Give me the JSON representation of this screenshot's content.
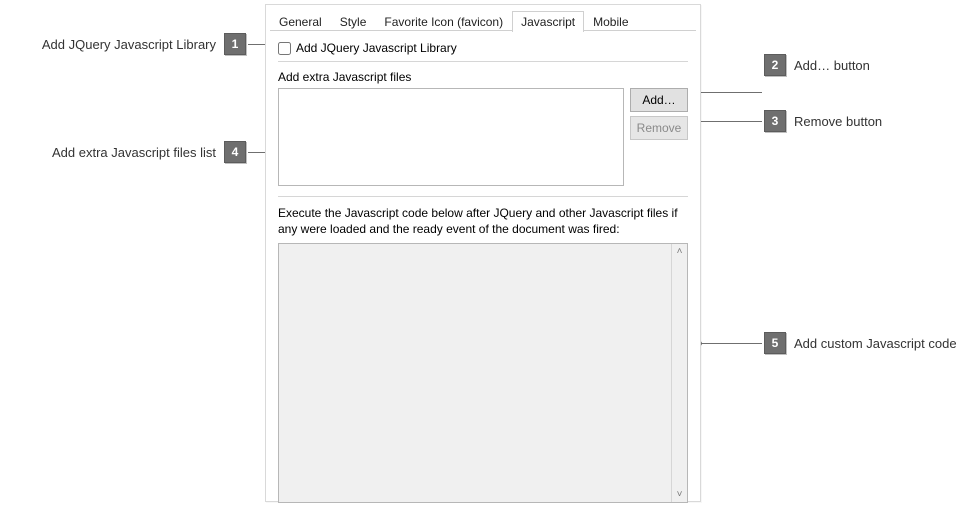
{
  "tabs": {
    "general": "General",
    "style": "Style",
    "favicon": "Favorite Icon (favicon)",
    "javascript": "Javascript",
    "mobile": "Mobile",
    "active": "javascript"
  },
  "jquery_checkbox_label": "Add JQuery Javascript Library",
  "extra_files_label": "Add extra Javascript files",
  "buttons": {
    "add": "Add…",
    "remove": "Remove"
  },
  "exec_label": "Execute the Javascript code below after JQuery and other Javascript files if any were loaded and the ready event of the document was fired:",
  "files_list": [],
  "code_value": "",
  "callouts": {
    "c1": "Add JQuery Javascript Library",
    "c2": "Add… button",
    "c3": "Remove button",
    "c4": "Add extra Javascript files list",
    "c5": "Add custom Javascript code"
  },
  "badges": {
    "b1": "1",
    "b2": "2",
    "b3": "3",
    "b4": "4",
    "b5": "5"
  }
}
